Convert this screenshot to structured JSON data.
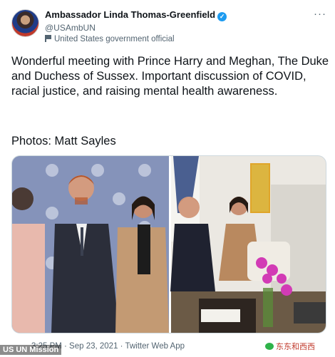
{
  "author": {
    "name": "Ambassador Linda Thomas-Greenfield",
    "handle": "@USAmbUN",
    "label": "United States government official"
  },
  "tweet": {
    "text": "Wonderful meeting with Prince Harry and Meghan, The Duke and Duchess of Sussex. Important discussion of COVID, racial justice, and raising mental health awareness.",
    "credit": "Photos: Matt Sayles"
  },
  "meta": {
    "time_date": "3:25 PM · Sep 23, 2021",
    "source": "· Twitter Web App"
  },
  "overlays": {
    "watermark": "US UN Mission",
    "brand": "东东和西西"
  },
  "icons": {
    "verified": "verified-badge-icon",
    "label": "flag-icon",
    "more": "more-icon",
    "brand": "wechat-icon"
  },
  "colors": {
    "verified": "#1d9bf0",
    "secondary_text": "#536471",
    "brand": "#c0392b"
  }
}
